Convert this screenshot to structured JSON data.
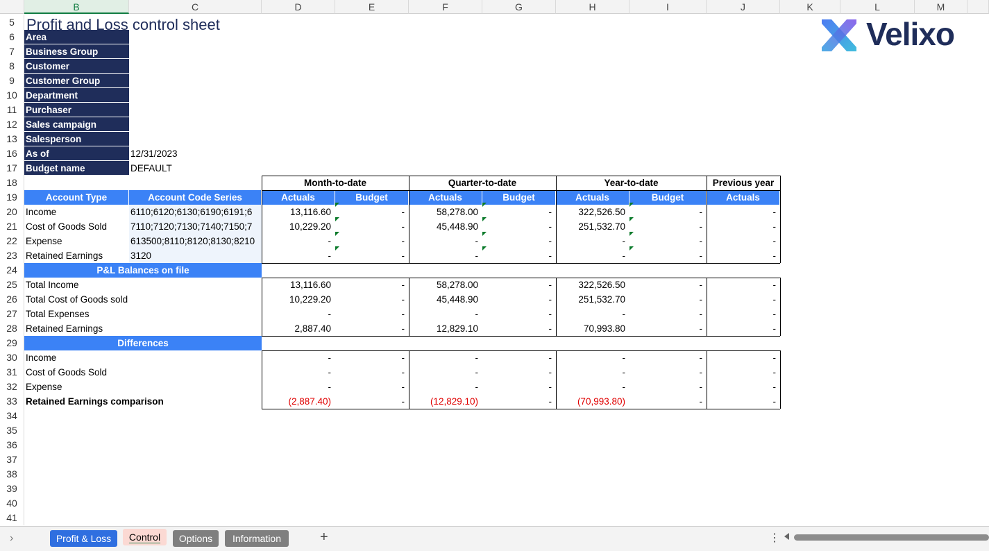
{
  "columns": [
    "B",
    "C",
    "D",
    "E",
    "F",
    "G",
    "H",
    "I",
    "J",
    "K",
    "L",
    "M"
  ],
  "rows": [
    "5",
    "6",
    "7",
    "8",
    "9",
    "10",
    "11",
    "12",
    "13",
    "16",
    "17",
    "18",
    "19",
    "20",
    "21",
    "22",
    "23",
    "24",
    "25",
    "26",
    "27",
    "28",
    "29",
    "30",
    "31",
    "32",
    "33",
    "34",
    "35",
    "36",
    "37",
    "38",
    "39",
    "40",
    "41"
  ],
  "title": "Profit and Loss control sheet",
  "logo": {
    "text": "Velixo"
  },
  "params": [
    {
      "label": "Area",
      "value": ""
    },
    {
      "label": "Business Group",
      "value": ""
    },
    {
      "label": "Customer",
      "value": ""
    },
    {
      "label": "Customer Group",
      "value": ""
    },
    {
      "label": "Department",
      "value": ""
    },
    {
      "label": "Purchaser",
      "value": ""
    },
    {
      "label": "Sales campaign",
      "value": ""
    },
    {
      "label": "Salesperson",
      "value": ""
    },
    {
      "label": "As of",
      "value": "12/31/2023"
    },
    {
      "label": "Budget name",
      "value": "DEFAULT"
    }
  ],
  "period_headers": [
    "Month-to-date",
    "Quarter-to-date",
    "Year-to-date",
    "Previous year"
  ],
  "sub_headers": [
    "Account Type",
    "Account Code Series",
    "Actuals",
    "Budget",
    "Actuals",
    "Budget",
    "Actuals",
    "Budget",
    "Actuals"
  ],
  "accounts": [
    {
      "type": "Income",
      "codes": "6110;6120;6130;6190;6191;6",
      "vals": [
        "13,116.60",
        "-",
        "58,278.00",
        "-",
        "322,526.50",
        "-",
        "-"
      ]
    },
    {
      "type": "Cost of Goods Sold",
      "codes": "7110;7120;7130;7140;7150;7",
      "vals": [
        "10,229.20",
        "-",
        "45,448.90",
        "-",
        "251,532.70",
        "-",
        "-"
      ]
    },
    {
      "type": "Expense",
      "codes": "613500;8110;8120;8130;8210",
      "vals": [
        "-",
        "-",
        "-",
        "-",
        "-",
        "-",
        "-"
      ]
    },
    {
      "type": "Retained Earnings",
      "codes": "3120",
      "vals": [
        "-",
        "-",
        "-",
        "-",
        "-",
        "-",
        "-"
      ]
    }
  ],
  "balances_header": "P&L Balances on file",
  "balances": [
    {
      "label": "Total Income",
      "vals": [
        "13,116.60",
        "-",
        "58,278.00",
        "-",
        "322,526.50",
        "-",
        "-"
      ]
    },
    {
      "label": "Total Cost of Goods sold",
      "vals": [
        "10,229.20",
        "-",
        "45,448.90",
        "-",
        "251,532.70",
        "-",
        "-"
      ]
    },
    {
      "label": "Total Expenses",
      "vals": [
        "-",
        "-",
        "-",
        "-",
        "-",
        "-",
        "-"
      ]
    },
    {
      "label": "Retained Earnings",
      "vals": [
        "2,887.40",
        "-",
        "12,829.10",
        "-",
        "70,993.80",
        "-",
        "-"
      ]
    }
  ],
  "differences_header": "Differences",
  "differences": [
    {
      "label": "Income",
      "vals": [
        "-",
        "-",
        "-",
        "-",
        "-",
        "-",
        "-"
      ]
    },
    {
      "label": "Cost of Goods Sold",
      "vals": [
        "-",
        "-",
        "-",
        "-",
        "-",
        "-",
        "-"
      ]
    },
    {
      "label": "Expense",
      "vals": [
        "-",
        "-",
        "-",
        "-",
        "-",
        "-",
        "-"
      ]
    },
    {
      "label": "Retained Earnings comparison",
      "vals": [
        "(2,887.40)",
        "-",
        "(12,829.10)",
        "-",
        "(70,993.80)",
        "-",
        "-"
      ]
    }
  ],
  "sheet_tabs": [
    {
      "label": "Profit & Loss",
      "active": false
    },
    {
      "label": "Control",
      "active": true
    },
    {
      "label": "Options",
      "active": false
    },
    {
      "label": "Information",
      "active": false
    }
  ],
  "tab_nav_icon": "chevron-right-icon",
  "add_sheet_icon": "plus-icon",
  "colors": {
    "navy": "#1f2d5a",
    "blue_header": "#3b82f6",
    "negative": "#e00000",
    "tab_blue": "#2f6fe0",
    "tab_grey": "#7f7f7f"
  }
}
